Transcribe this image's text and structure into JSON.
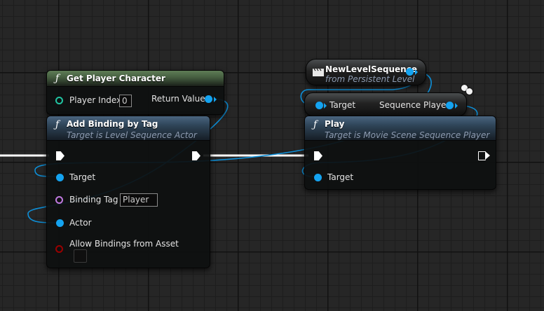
{
  "colors": {
    "object_pin": "#14a3f0",
    "name_pin": "#c07ae0",
    "bool_pin": "#9a0000",
    "exec_wire": "#ffffff",
    "object_wire": "#0d8fd8",
    "pure_header": "#5e7d56",
    "impure_header": "#4a6580",
    "grid_background": "#262626"
  },
  "get_player_character": {
    "icon": "function-icon",
    "function_glyph": "ƒ",
    "title": "Get Player Character",
    "player_index_label": "Player Index",
    "player_index_value": "0",
    "return_value_label": "Return Value"
  },
  "add_binding_by_tag": {
    "icon": "function-icon",
    "function_glyph": "ƒ",
    "title": "Add Binding by Tag",
    "subtitle": "Target is Level Sequence Actor",
    "target_label": "Target",
    "binding_tag_label": "Binding Tag",
    "binding_tag_value": "Player",
    "actor_label": "Actor",
    "allow_bindings_label": "Allow Bindings from Asset",
    "allow_bindings_checked": false
  },
  "new_level_sequence": {
    "icon": "clapperboard-icon",
    "title": "NewLevelSequence",
    "subtitle": "from Persistent Level"
  },
  "sequence_player_node": {
    "target_label": "Target",
    "output_label": "Sequence Player"
  },
  "play": {
    "icon": "function-icon",
    "function_glyph": "ƒ",
    "title": "Play",
    "subtitle": "Target is Movie Scene Sequence Player",
    "target_label": "Target"
  }
}
